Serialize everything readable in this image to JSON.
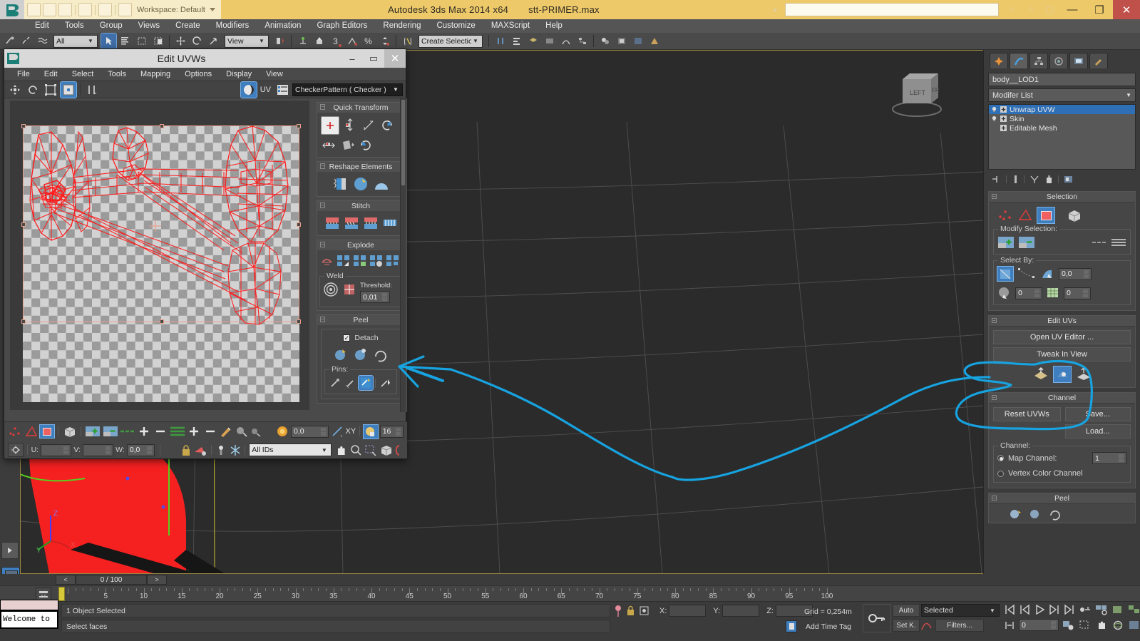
{
  "app": {
    "title": "Autodesk 3ds Max  2014 x64",
    "file": "stt-PRIMER.max",
    "workspace": "Workspace: Default",
    "window_buttons": {
      "minimize": "—",
      "maximize": "❐",
      "close": "✕"
    }
  },
  "menubar": {
    "items": [
      "Edit",
      "Tools",
      "Group",
      "Views",
      "Create",
      "Modifiers",
      "Animation",
      "Graph Editors",
      "Rendering",
      "Customize",
      "MAXScript",
      "Help"
    ]
  },
  "main_toolbar": {
    "selection_filter": "All",
    "reference_coord": "View",
    "named_selection_sets": "Create Selection Set",
    "angle_snap_value": "3",
    "percent_snap": "%"
  },
  "viewport": {
    "view_cube_faces": [
      "LEFT",
      "FRONT"
    ],
    "axis_labels": {
      "z": "Z",
      "y": "Y",
      "x": "X"
    },
    "grid_text": "Grid = 0,254m"
  },
  "uvw_window": {
    "title": "Edit UVWs",
    "window_buttons": {
      "minimize": "–",
      "maximize": "▭",
      "close": "✕"
    },
    "menu": [
      "File",
      "Edit",
      "Select",
      "Tools",
      "Mapping",
      "Options",
      "Display",
      "View"
    ],
    "toolbar": {
      "uv_label": "UV",
      "map_selector": "CheckerPattern  ( Checker )"
    },
    "rollouts": [
      {
        "label": "Quick Transform"
      },
      {
        "label": "Reshape Elements"
      },
      {
        "label": "Stitch"
      },
      {
        "label": "Explode"
      },
      {
        "label": "Peel"
      }
    ],
    "weld": {
      "group_label": "Weld",
      "threshold_label": "Threshold:",
      "threshold_value": "0,01"
    },
    "peel": {
      "detach_label": "Detach",
      "detach_checked": true,
      "pins_label": "Pins:"
    },
    "bottom": {
      "u_label": "U:",
      "u_value": "",
      "v_label": "V:",
      "v_value": "",
      "w_label": "W:",
      "w_value": "0,0",
      "rotate_value": "0,0",
      "xy_label": "XY",
      "grid_value": "16",
      "id_filter": "All IDs"
    },
    "uv_shell_color": "#ff1a1a",
    "gizmo_color": "#e8a08a"
  },
  "command_panel": {
    "object_name": "body__LOD1",
    "modifier_list_label": "Modifer List",
    "modifiers": [
      {
        "name": "Unwrap UVW",
        "selected": true
      },
      {
        "name": "Skin",
        "selected": false
      },
      {
        "name": "Editable Mesh",
        "selected": false
      }
    ],
    "selection": {
      "title": "Selection",
      "modify_selection_label": "Modify Selection:",
      "select_by_label": "Select By:",
      "angle_value": "0,0",
      "material_id_value": "0",
      "smoothing_group_value": "0"
    },
    "edit_uvs": {
      "title": "Edit UVs",
      "open_uv_editor": "Open UV Editor ...",
      "tweak_in_view": "Tweak In View"
    },
    "channel": {
      "title": "Channel",
      "reset_uvws": "Reset UVWs",
      "save": "Save...",
      "load": "Load...",
      "group_label": "Channel:",
      "map_channel_label": "Map Channel:",
      "map_channel_value": "1",
      "vertex_color_label": "Vertex Color Channel",
      "map_channel_selected": true
    },
    "peel": {
      "title": "Peel"
    }
  },
  "timeline": {
    "frame_display": "0 / 100",
    "prev_arrow": "<",
    "next_arrow": ">",
    "tick_labels": [
      "5",
      "10",
      "15",
      "20",
      "25",
      "30",
      "35",
      "40",
      "45",
      "50",
      "55",
      "60",
      "65",
      "70",
      "75",
      "80",
      "85",
      "90",
      "95",
      "100"
    ],
    "range_start": 0,
    "range_end": 100
  },
  "status_bar": {
    "objects_selected": "1 Object Selected",
    "prompt": "Select faces",
    "x_label": "X:",
    "x_value": "",
    "y_label": "Y:",
    "y_value": "",
    "z_label": "Z:",
    "z_value": "",
    "grid": "Grid = 0,254m",
    "add_time_tag": "Add Time Tag",
    "auto_key": "Auto",
    "set_key": "Set K.",
    "key_filter_mode": "Selected",
    "filters": "Filters...",
    "current_frame": "0"
  },
  "taskbar": {
    "welcome_text": "Welcome to"
  },
  "annotation": {
    "color": "#17a3e0",
    "arrow_color": "#2c8fe0"
  }
}
